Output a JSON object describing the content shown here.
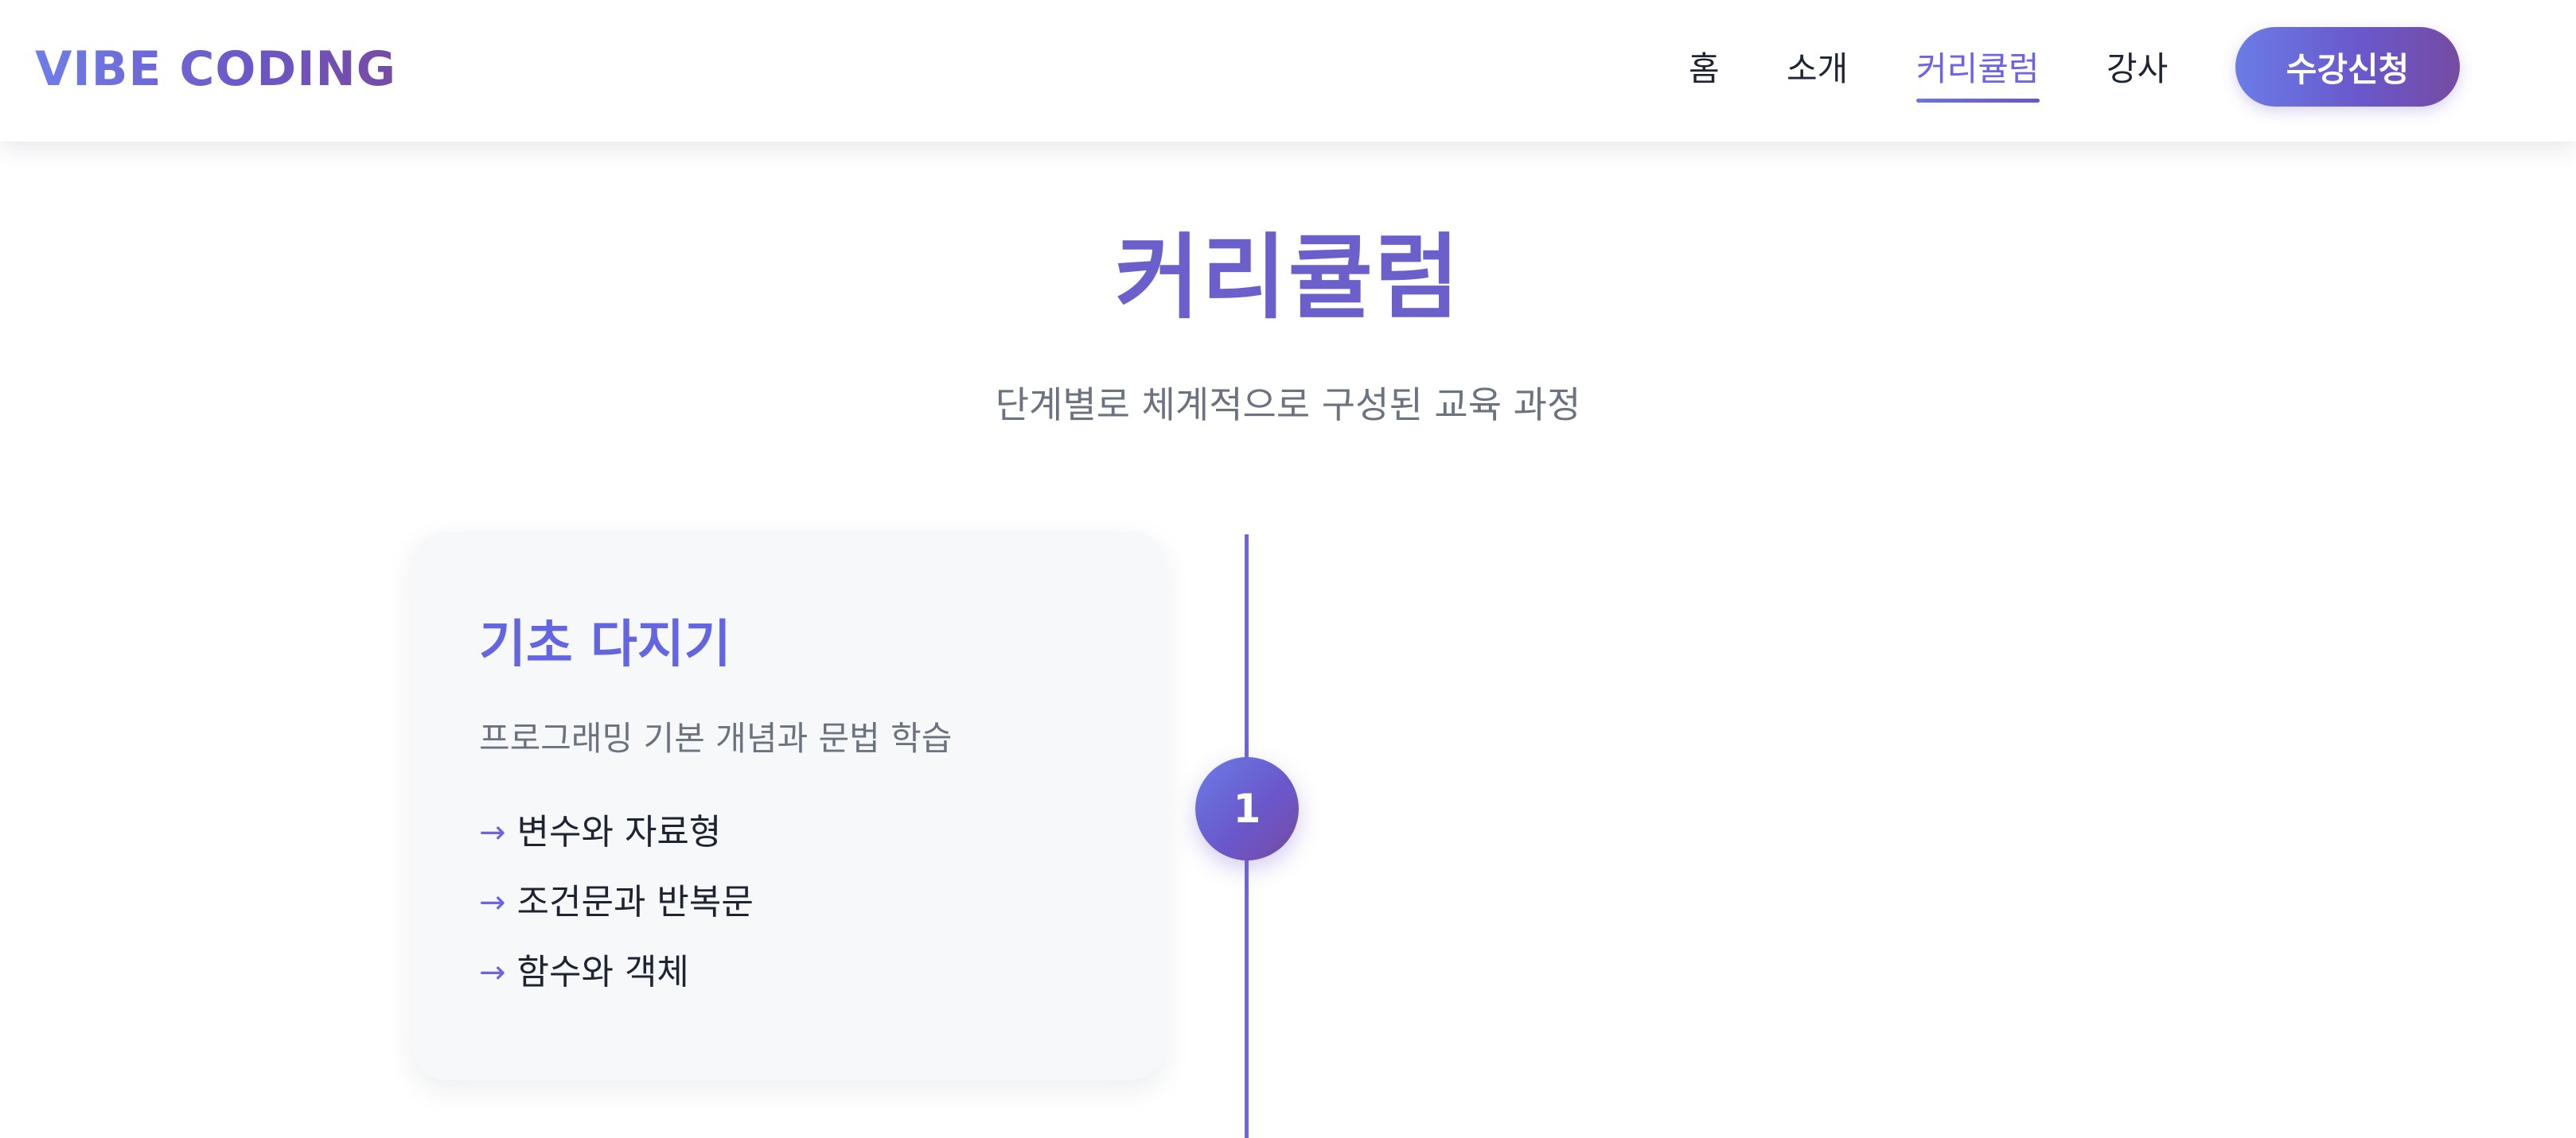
{
  "header": {
    "logo": "VIBE CODING",
    "nav": {
      "home": "홈",
      "about": "소개",
      "curriculum": "커리큘럼",
      "instructor": "강사"
    },
    "enroll_label": "수강신청"
  },
  "section": {
    "title": "커리큘럼",
    "subtitle": "단계별로 체계적으로 구성된 교육 과정"
  },
  "timeline": {
    "steps": [
      {
        "number": "1",
        "title": "기초 다지기",
        "description": "프로그래밍 기본 개념과 문법 학습",
        "topics": [
          "변수와 자료형",
          "조건문과 반복문",
          "함수와 객체"
        ]
      }
    ]
  },
  "colors": {
    "accent": "#6c63e6",
    "gradient_start": "#667eea",
    "gradient_end": "#764ba2",
    "card_bg": "#f7f8fa",
    "muted_text": "#6b7280"
  },
  "icons": {
    "topic_bullet": "arrow-right-icon"
  }
}
